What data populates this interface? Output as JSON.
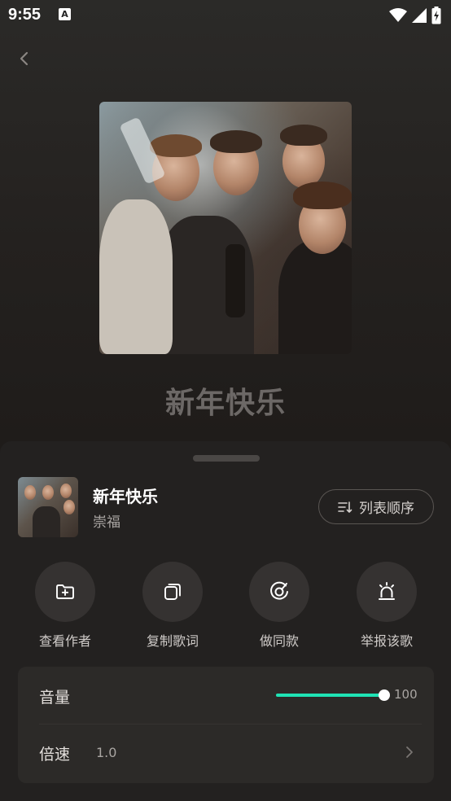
{
  "status": {
    "time": "9:55",
    "notification_glyph": "A"
  },
  "header": {
    "back_icon": "chevron-left-icon"
  },
  "player": {
    "title": "新年快乐"
  },
  "sheet": {
    "song": {
      "title": "新年快乐",
      "artist": "崇福"
    },
    "order_button": {
      "label": "列表顺序",
      "icon": "list-order-icon"
    },
    "actions": [
      {
        "label": "查看作者",
        "icon": "folder-plus-icon"
      },
      {
        "label": "复制歌词",
        "icon": "copy-icon"
      },
      {
        "label": "做同款",
        "icon": "record-icon"
      },
      {
        "label": "举报该歌",
        "icon": "alarm-icon"
      }
    ],
    "volume": {
      "label": "音量",
      "value": "100",
      "level": 1.0
    },
    "speed": {
      "label": "倍速",
      "value": "1.0"
    }
  },
  "colors": {
    "accent": "#1fe3b5",
    "sheet_bg": "#232120",
    "card_bg": "#2c2a28"
  }
}
